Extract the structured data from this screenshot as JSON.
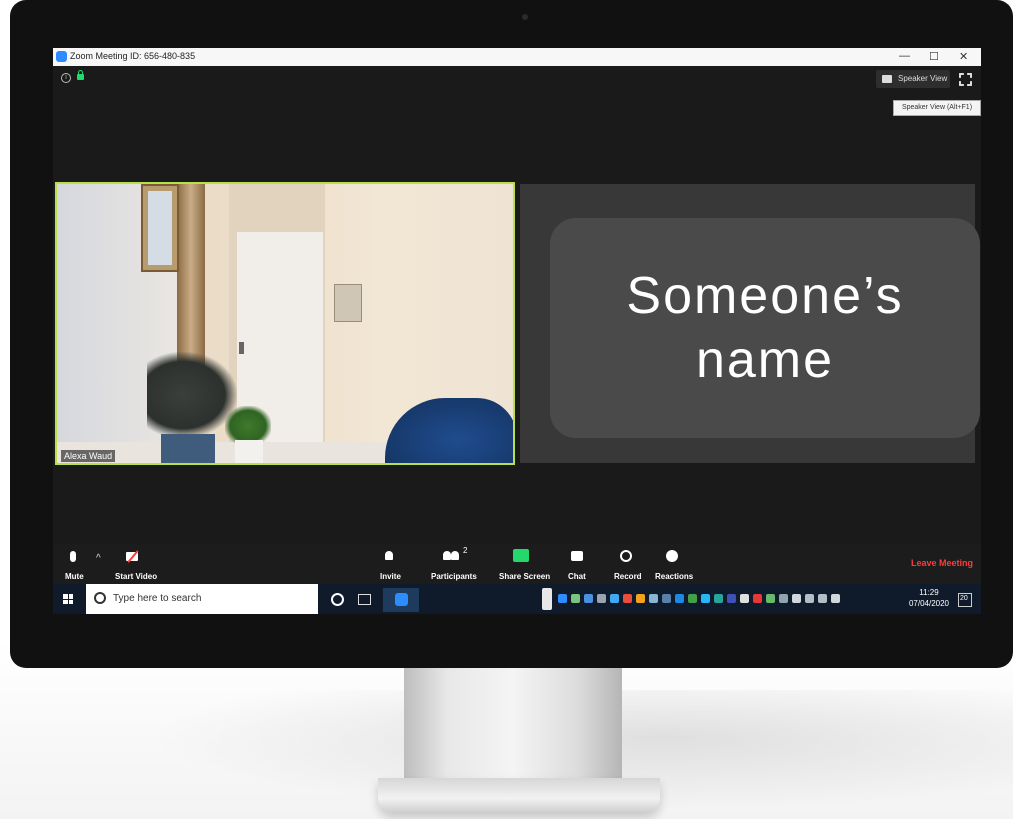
{
  "window": {
    "title": "Zoom Meeting ID: 656-480-835",
    "minimize": "—",
    "maximize": "☐",
    "close": "✕"
  },
  "topbar": {
    "speaker_view_label": "Speaker View",
    "tooltip": "Speaker View (Alt+F1)"
  },
  "participants": {
    "self_name": "Alexa Waud",
    "other_name": "Someone’s name"
  },
  "toolbar": {
    "mute": "Mute",
    "start_video": "Start Video",
    "invite": "Invite",
    "participants": "Participants",
    "participants_count": "2",
    "share_screen": "Share Screen",
    "chat": "Chat",
    "record": "Record",
    "reactions": "Reactions",
    "leave": "Leave Meeting"
  },
  "taskbar": {
    "search_placeholder": "Type here to search",
    "time": "11:29",
    "date": "07/04/2020",
    "notification_count": "20"
  },
  "colors": {
    "accent": "#2d8cff",
    "active_border": "#b7e04a",
    "share_green": "#23d96c",
    "leave_red": "#ff3b3b"
  }
}
